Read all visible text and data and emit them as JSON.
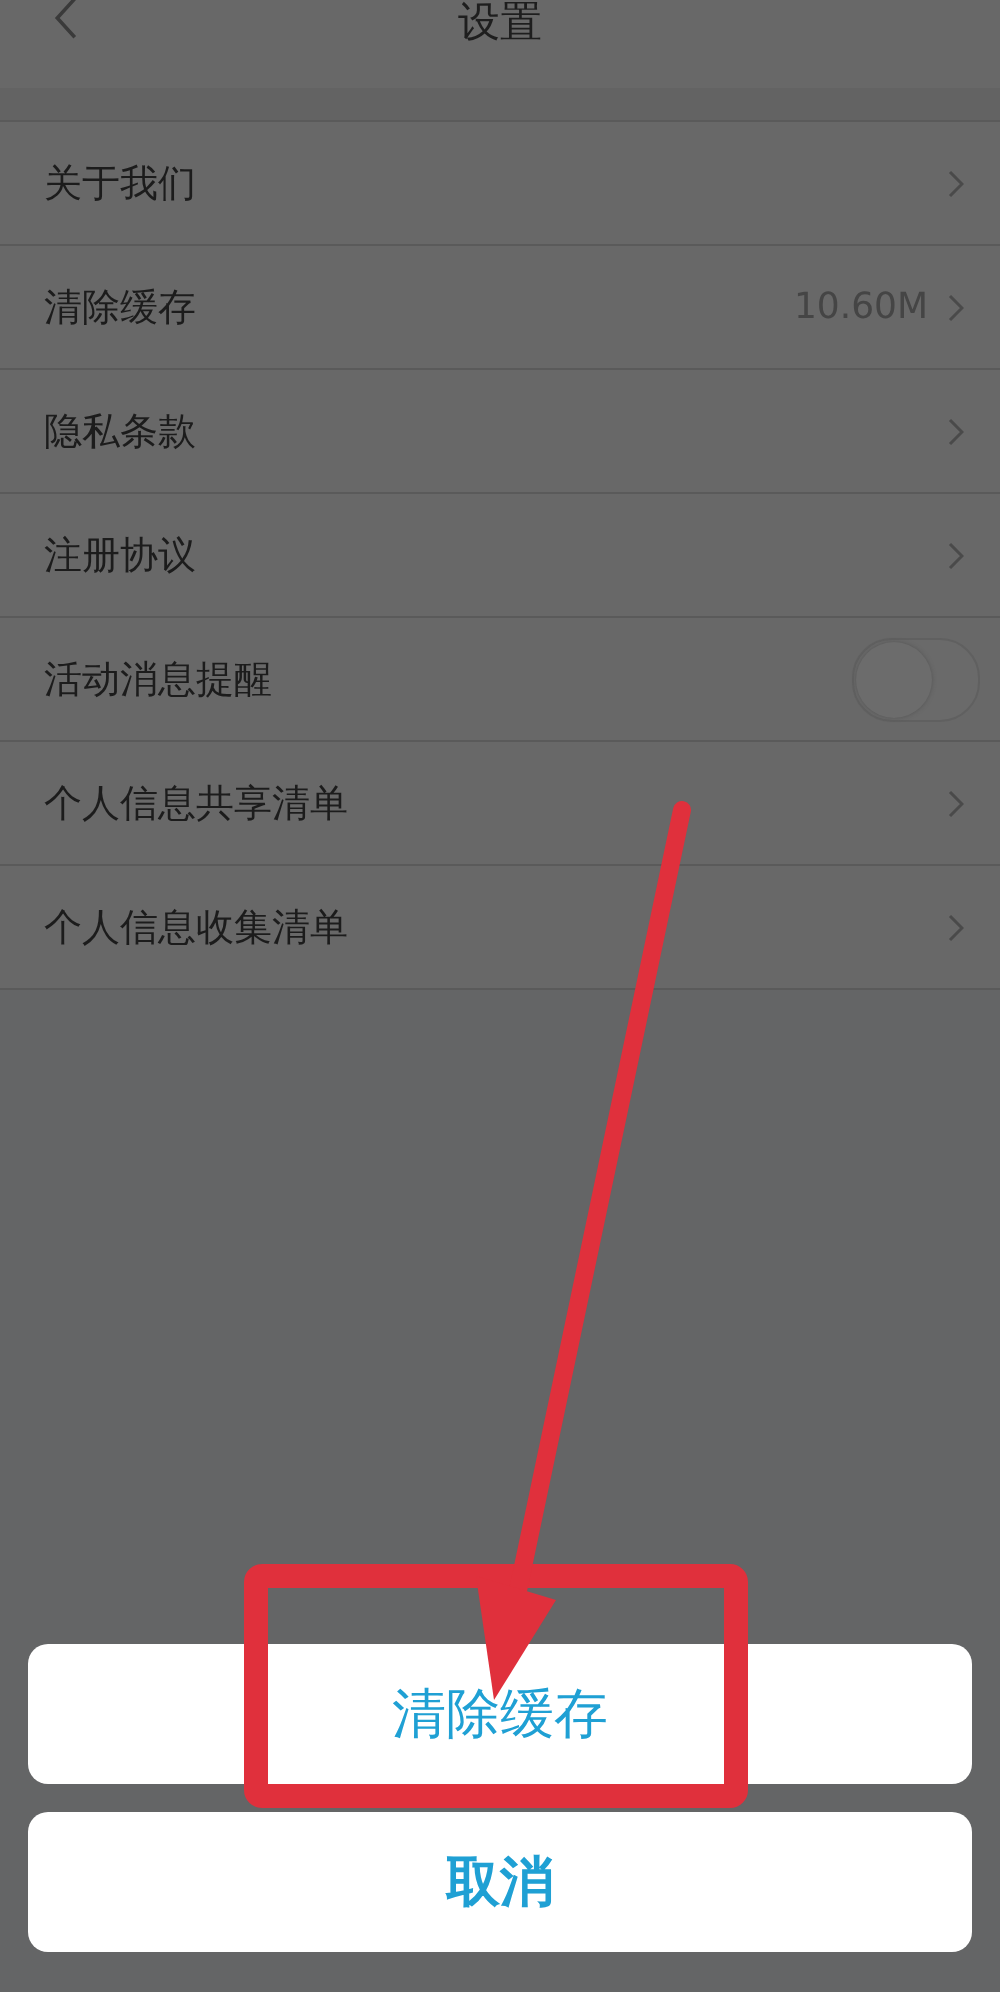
{
  "header": {
    "title": "设置"
  },
  "settings": [
    {
      "kind": "link",
      "label": "关于我们"
    },
    {
      "kind": "link",
      "label": "清除缓存",
      "value": "10.60M"
    },
    {
      "kind": "link",
      "label": "隐私条款"
    },
    {
      "kind": "link",
      "label": "注册协议"
    },
    {
      "kind": "switch",
      "label": "活动消息提醒",
      "on": false
    },
    {
      "kind": "link",
      "label": "个人信息共享清单"
    },
    {
      "kind": "link",
      "label": "个人信息收集清单"
    }
  ],
  "action_sheet": {
    "buttons": [
      {
        "label": "清除缓存",
        "kind": "action"
      },
      {
        "label": "取消",
        "kind": "cancel"
      }
    ]
  }
}
